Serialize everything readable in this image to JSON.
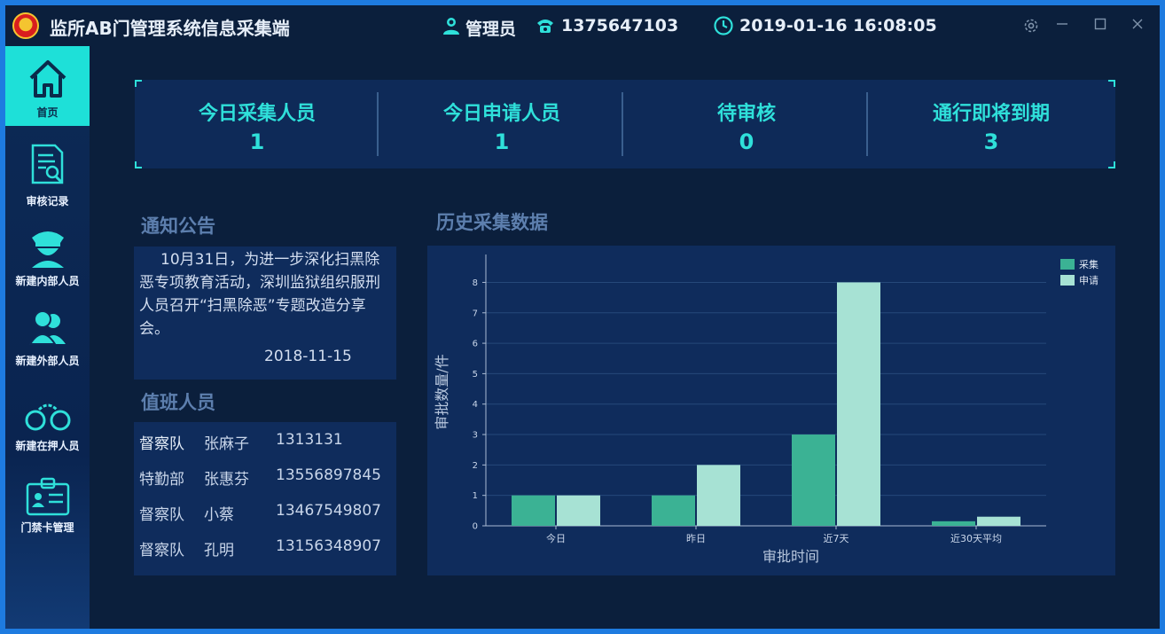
{
  "titlebar": {
    "app_title": "监所AB门管理系统信息采集端",
    "user": "管理员",
    "phone": "1375647103",
    "datetime": "2019-01-16 16:08:05"
  },
  "sidebar": {
    "items": [
      {
        "label": "首页",
        "icon": "home-icon",
        "active": true
      },
      {
        "label": "审核记录",
        "icon": "document-search-icon",
        "active": false
      },
      {
        "label": "新建内部人员",
        "icon": "police-officer-icon",
        "active": false
      },
      {
        "label": "新建外部人员",
        "icon": "users-icon",
        "active": false
      },
      {
        "label": "新建在押人员",
        "icon": "handcuffs-icon",
        "active": false
      },
      {
        "label": "门禁卡管理",
        "icon": "id-card-icon",
        "active": false
      }
    ]
  },
  "stats": [
    {
      "title": "今日采集人员",
      "value": "1"
    },
    {
      "title": "今日申请人员",
      "value": "1"
    },
    {
      "title": "待审核",
      "value": "0"
    },
    {
      "title": "通行即将到期",
      "value": "3"
    }
  ],
  "notice": {
    "title": "通知公告",
    "text": "10月31日，为进一步深化扫黑除恶专项教育活动，深圳监狱组织服刑人员召开“扫黑除恶”专题改造分享会。",
    "date": "2018-11-15"
  },
  "duty": {
    "title": "值班人员",
    "rows": [
      {
        "dept": "督察队",
        "name": "张麻子",
        "phone": "1313131"
      },
      {
        "dept": "特勤部",
        "name": "张惠芬",
        "phone": "13556897845"
      },
      {
        "dept": "督察队",
        "name": "小蔡",
        "phone": "13467549807"
      },
      {
        "dept": "督察队",
        "name": "孔明",
        "phone": "13156348907"
      }
    ]
  },
  "history": {
    "title": "历史采集数据"
  },
  "chart_data": {
    "type": "bar",
    "categories": [
      "今日",
      "昨日",
      "近7天",
      "近30天平均"
    ],
    "series": [
      {
        "name": "采集",
        "values": [
          1,
          1,
          3,
          0.15
        ],
        "color": "#3bb294"
      },
      {
        "name": "申请",
        "values": [
          1,
          2,
          8,
          0.3
        ],
        "color": "#a7e2d4"
      }
    ],
    "xlabel": "审批时间",
    "ylabel": "审批数量/件",
    "ylim": [
      0,
      8.8
    ],
    "yticks": [
      0,
      1,
      2,
      3,
      4,
      5,
      6,
      7,
      8
    ],
    "grid": true,
    "legend": "top-right"
  },
  "colors": {
    "accent": "#2fe0da",
    "background": "#0b1f3c",
    "panel": "#0f2c5c"
  }
}
